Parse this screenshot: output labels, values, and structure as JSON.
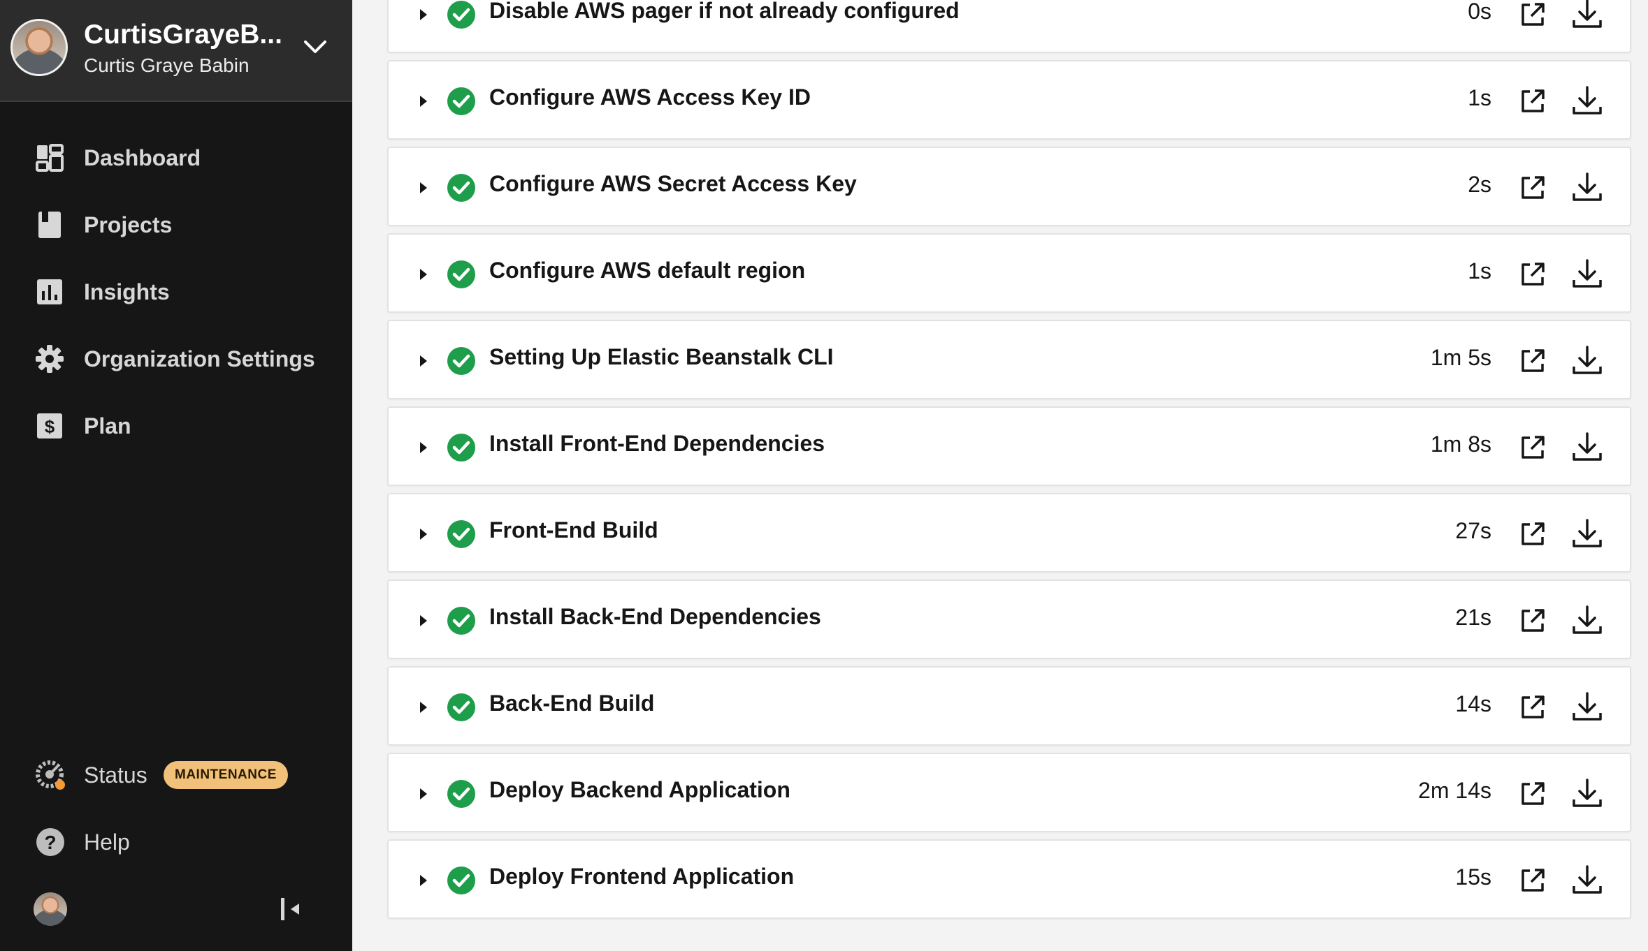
{
  "org": {
    "name": "CurtisGrayeB...",
    "user": "Curtis Graye Babin"
  },
  "nav": {
    "dashboard": "Dashboard",
    "projects": "Projects",
    "insights": "Insights",
    "org_settings": "Organization Settings",
    "plan": "Plan"
  },
  "bottom": {
    "status": "Status",
    "status_badge": "MAINTENANCE",
    "help": "Help"
  },
  "colors": {
    "success": "#1e9e4a",
    "badge": "#f1c17a",
    "sidebar": "#161616"
  },
  "steps": [
    {
      "title": "Disable AWS pager if not already configured",
      "duration": "0s",
      "status": "success"
    },
    {
      "title": "Configure AWS Access Key ID",
      "duration": "1s",
      "status": "success"
    },
    {
      "title": "Configure AWS Secret Access Key",
      "duration": "2s",
      "status": "success"
    },
    {
      "title": "Configure AWS default region",
      "duration": "1s",
      "status": "success"
    },
    {
      "title": "Setting Up Elastic Beanstalk CLI",
      "duration": "1m 5s",
      "status": "success"
    },
    {
      "title": "Install Front-End Dependencies",
      "duration": "1m 8s",
      "status": "success"
    },
    {
      "title": "Front-End Build",
      "duration": "27s",
      "status": "success"
    },
    {
      "title": "Install Back-End Dependencies",
      "duration": "21s",
      "status": "success"
    },
    {
      "title": "Back-End Build",
      "duration": "14s",
      "status": "success"
    },
    {
      "title": "Deploy Backend Application",
      "duration": "2m 14s",
      "status": "success"
    },
    {
      "title": "Deploy Frontend Application",
      "duration": "15s",
      "status": "success"
    }
  ]
}
